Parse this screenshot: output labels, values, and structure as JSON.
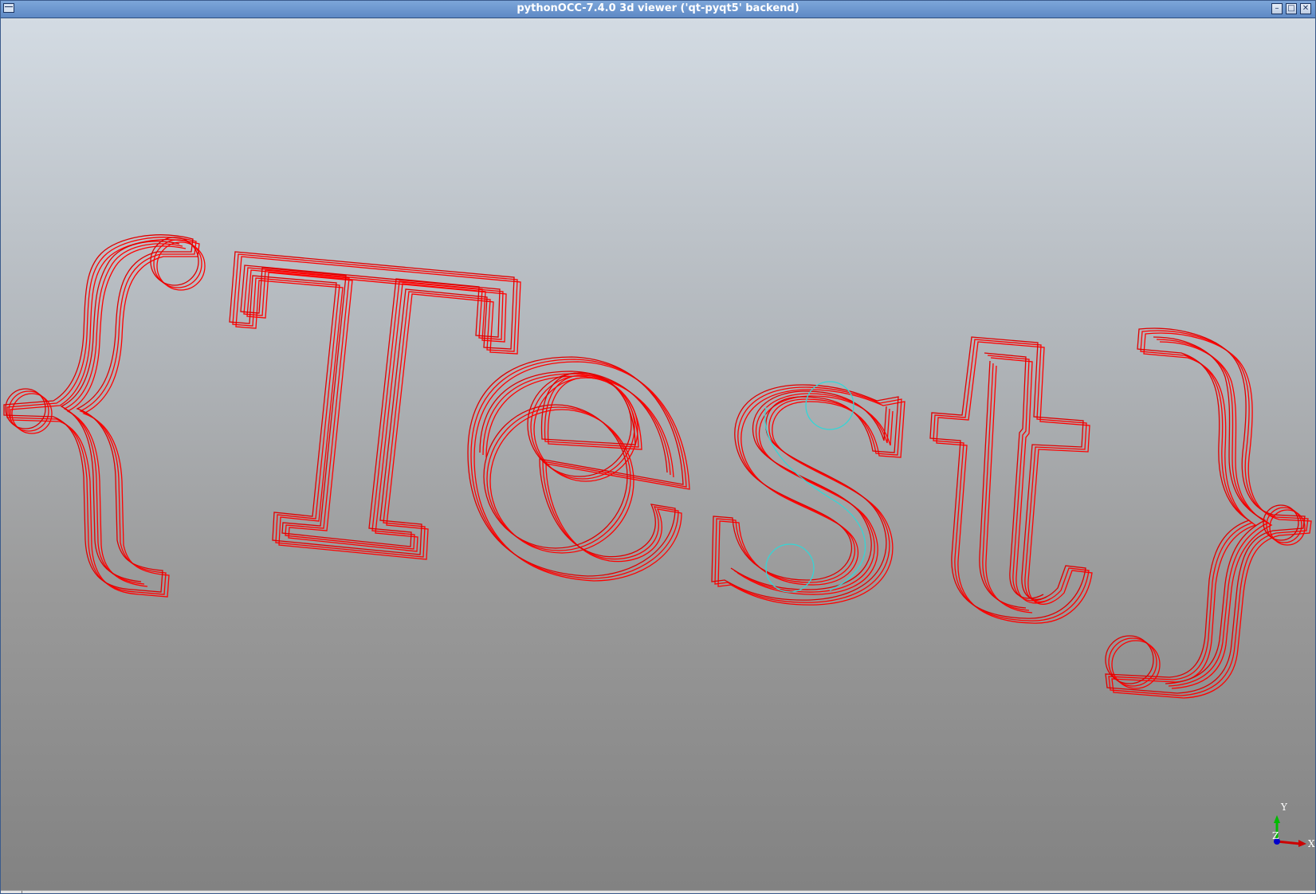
{
  "window": {
    "title": "pythonOCC-7.4.0 3d viewer ('qt-pyqt5' backend)"
  },
  "controls": {
    "minimize_glyph": "–",
    "maximize_glyph": "□",
    "close_glyph": "✕"
  },
  "viewport": {
    "background_top": "#d3dbe3",
    "background_bottom": "#828282"
  },
  "scene": {
    "text": "{Test}",
    "outline_color": "#ff0000",
    "highlight_color": "#33d6d6"
  },
  "triedron": {
    "x_label": "X",
    "y_label": "Y",
    "z_label": "Z",
    "x_color": "#cc0000",
    "y_color": "#00bb00",
    "z_color": "#0000cc"
  }
}
